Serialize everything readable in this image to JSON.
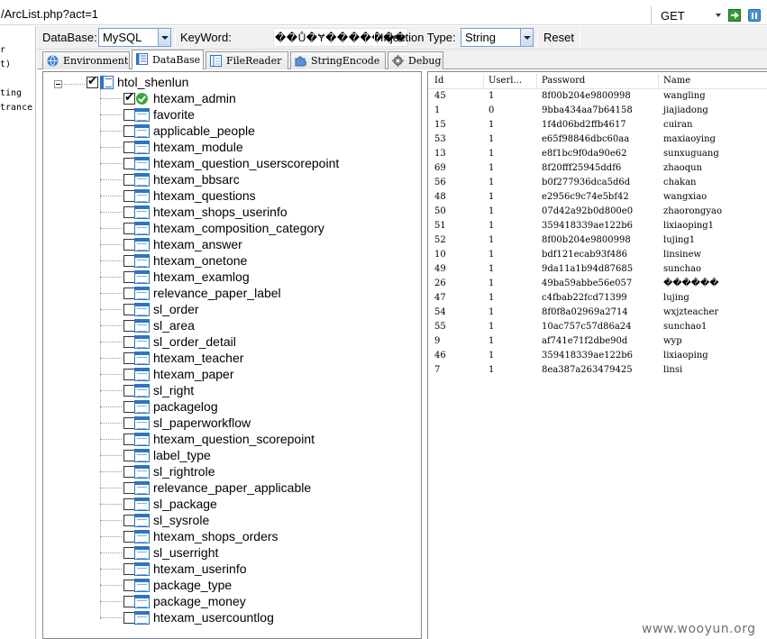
{
  "urlbar": {
    "url": "/ArcList.php?act=1",
    "method": "GET"
  },
  "left_strip": {
    "lines": [
      "r",
      "t)",
      "ting",
      "trance"
    ]
  },
  "toolbar": {
    "database_label": "DataBase:",
    "database_value": "MySQL",
    "keyword_label": "KeyWord:",
    "keyword_value": "��Ů�Ɏ�������",
    "injection_label": "Injection Type:",
    "injection_value": "String",
    "reset_label": "Reset"
  },
  "tabs": [
    {
      "label": "Environment",
      "icon": "globe-icon",
      "active": false
    },
    {
      "label": "DataBase",
      "icon": "database-icon",
      "active": true
    },
    {
      "label": "FileReader",
      "icon": "file-icon",
      "active": false
    },
    {
      "label": "StringEncode",
      "icon": "puzzle-icon",
      "active": false
    },
    {
      "label": "Debug",
      "icon": "gear-icon",
      "active": false
    }
  ],
  "tree": {
    "root": "htol_shenlun",
    "tables": [
      {
        "name": "htexam_admin",
        "checked": true
      },
      {
        "name": "favorite",
        "checked": false
      },
      {
        "name": "applicable_people",
        "checked": false
      },
      {
        "name": "htexam_module",
        "checked": false
      },
      {
        "name": "htexam_question_userscorepoint",
        "checked": false
      },
      {
        "name": "htexam_bbsarc",
        "checked": false
      },
      {
        "name": "htexam_questions",
        "checked": false
      },
      {
        "name": "htexam_shops_userinfo",
        "checked": false
      },
      {
        "name": "htexam_composition_category",
        "checked": false
      },
      {
        "name": "htexam_answer",
        "checked": false
      },
      {
        "name": "htexam_onetone",
        "checked": false
      },
      {
        "name": "htexam_examlog",
        "checked": false
      },
      {
        "name": "relevance_paper_label",
        "checked": false
      },
      {
        "name": "sl_order",
        "checked": false
      },
      {
        "name": "sl_area",
        "checked": false
      },
      {
        "name": "sl_order_detail",
        "checked": false
      },
      {
        "name": "htexam_teacher",
        "checked": false
      },
      {
        "name": "htexam_paper",
        "checked": false
      },
      {
        "name": "sl_right",
        "checked": false
      },
      {
        "name": "packagelog",
        "checked": false
      },
      {
        "name": "sl_paperworkflow",
        "checked": false
      },
      {
        "name": "htexam_question_scorepoint",
        "checked": false
      },
      {
        "name": "label_type",
        "checked": false
      },
      {
        "name": "sl_rightrole",
        "checked": false
      },
      {
        "name": "relevance_paper_applicable",
        "checked": false
      },
      {
        "name": "sl_package",
        "checked": false
      },
      {
        "name": "sl_sysrole",
        "checked": false
      },
      {
        "name": "htexam_shops_orders",
        "checked": false
      },
      {
        "name": "sl_userright",
        "checked": false
      },
      {
        "name": "htexam_userinfo",
        "checked": false
      },
      {
        "name": "package_type",
        "checked": false
      },
      {
        "name": "package_money",
        "checked": false
      },
      {
        "name": "htexam_usercountlog",
        "checked": false
      }
    ]
  },
  "grid": {
    "columns": [
      "Id",
      "Userl...",
      "Password",
      "Name"
    ],
    "rows": [
      [
        "45",
        "1",
        "8f00b204e9800998",
        "wangling"
      ],
      [
        "1",
        "0",
        "9bba434aa7b64158",
        "jiajiadong"
      ],
      [
        "15",
        "1",
        "1f4d06bd2ffb4617",
        "cuiran"
      ],
      [
        "53",
        "1",
        "e65f98846dbc60aa",
        "maxiaoying"
      ],
      [
        "13",
        "1",
        "e8f1bc9f0da90e62",
        "sunxuguang"
      ],
      [
        "69",
        "1",
        "8f20fff25945ddf6",
        "zhaoqun"
      ],
      [
        "56",
        "1",
        "b0f277936dca5d6d",
        "chakan"
      ],
      [
        "48",
        "1",
        "e2956c9c74e5bf42",
        "wangxiao"
      ],
      [
        "50",
        "1",
        "07d42a92b0d800e0",
        "zhaorongyao"
      ],
      [
        "51",
        "1",
        "359418339ae122b6",
        "lixiaoping1"
      ],
      [
        "52",
        "1",
        "8f00b204e9800998",
        "lujing1"
      ],
      [
        "10",
        "1",
        "bdf121ecab93f486",
        "linsinew"
      ],
      [
        "49",
        "1",
        "9da11a1b94d87685",
        "sunchao"
      ],
      [
        "26",
        "1",
        "49ba59abbe56e057",
        "������"
      ],
      [
        "47",
        "1",
        "c4fbab22fcd71399",
        "lujing"
      ],
      [
        "54",
        "1",
        "8f0f8a02969a2714",
        "wxjzteacher"
      ],
      [
        "55",
        "1",
        "10ac757c57d86a24",
        "sunchao1"
      ],
      [
        "9",
        "1",
        "af741e71f2dbe90d",
        "wyp"
      ],
      [
        "46",
        "1",
        "359418339ae122b6",
        "lixiaoping"
      ],
      [
        "7",
        "1",
        "8ea387a263479425",
        "linsi"
      ]
    ]
  },
  "watermark": "www.wooyun.org"
}
